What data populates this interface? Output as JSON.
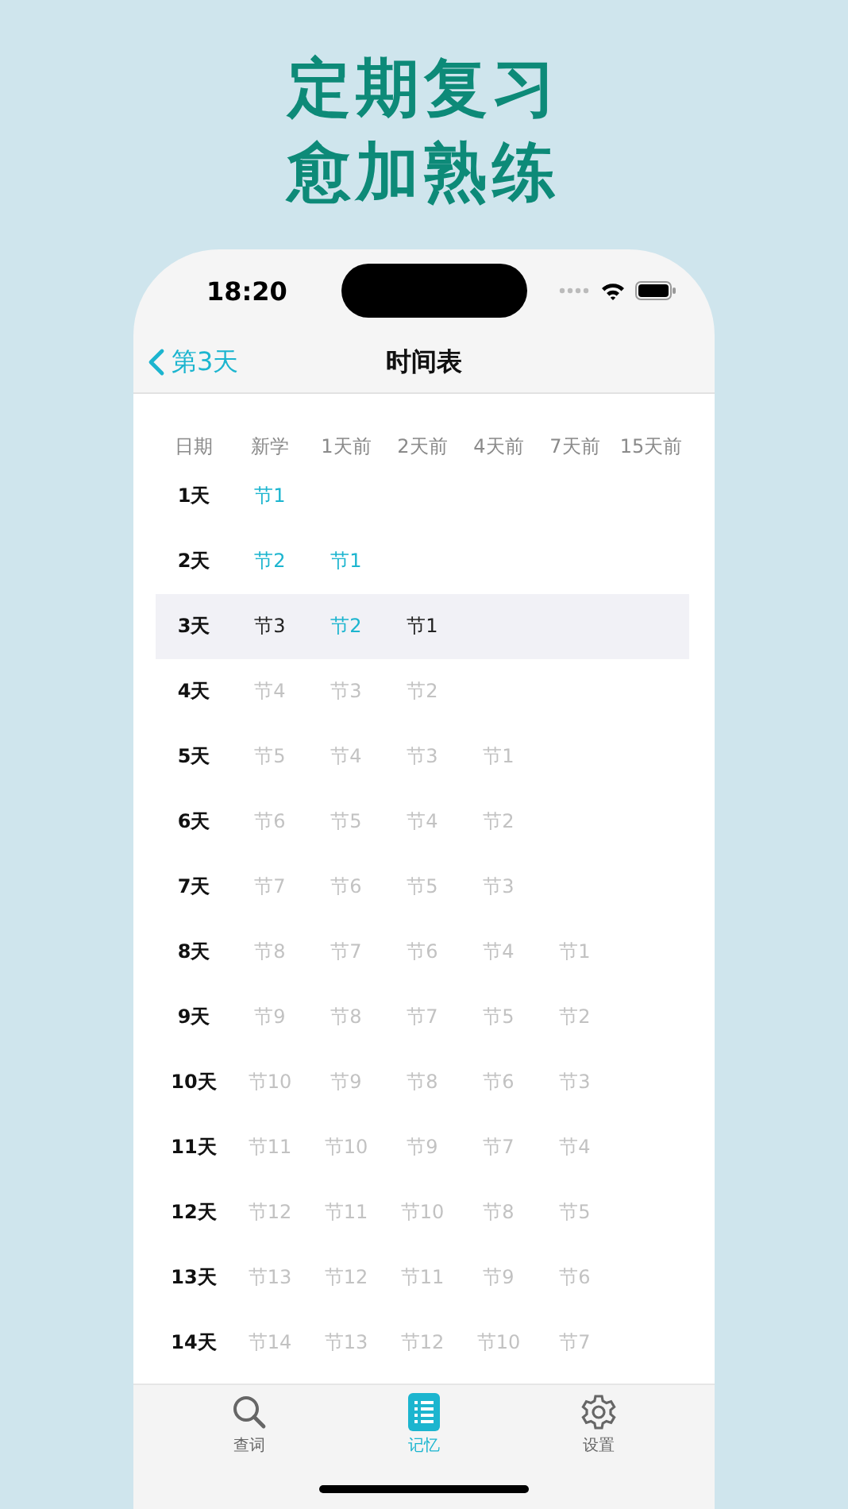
{
  "headline": [
    "定期复习",
    "愈加熟练"
  ],
  "status_bar": {
    "time": "18:20"
  },
  "nav": {
    "back": "第3天",
    "title": "时间表"
  },
  "table": {
    "columns": [
      "日期",
      "新学",
      "1天前",
      "2天前",
      "4天前",
      "7天前",
      "15天前"
    ],
    "rows": [
      {
        "selected": false,
        "cells": [
          {
            "text": "1天",
            "kind": "day"
          },
          {
            "text": "节1",
            "kind": "review"
          }
        ]
      },
      {
        "selected": false,
        "cells": [
          {
            "text": "2天",
            "kind": "day"
          },
          {
            "text": "节2",
            "kind": "review"
          },
          {
            "text": "节1",
            "kind": "review"
          }
        ]
      },
      {
        "selected": true,
        "cells": [
          {
            "text": "3天",
            "kind": "day"
          },
          {
            "text": "节3",
            "kind": "current"
          },
          {
            "text": "节2",
            "kind": "review"
          },
          {
            "text": "节1",
            "kind": "current"
          }
        ]
      },
      {
        "selected": false,
        "cells": [
          {
            "text": "4天",
            "kind": "day"
          },
          {
            "text": "节4",
            "kind": "future"
          },
          {
            "text": "节3",
            "kind": "future"
          },
          {
            "text": "节2",
            "kind": "future"
          }
        ]
      },
      {
        "selected": false,
        "cells": [
          {
            "text": "5天",
            "kind": "day"
          },
          {
            "text": "节5",
            "kind": "future"
          },
          {
            "text": "节4",
            "kind": "future"
          },
          {
            "text": "节3",
            "kind": "future"
          },
          {
            "text": "节1",
            "kind": "future"
          }
        ]
      },
      {
        "selected": false,
        "cells": [
          {
            "text": "6天",
            "kind": "day"
          },
          {
            "text": "节6",
            "kind": "future"
          },
          {
            "text": "节5",
            "kind": "future"
          },
          {
            "text": "节4",
            "kind": "future"
          },
          {
            "text": "节2",
            "kind": "future"
          }
        ]
      },
      {
        "selected": false,
        "cells": [
          {
            "text": "7天",
            "kind": "day"
          },
          {
            "text": "节7",
            "kind": "future"
          },
          {
            "text": "节6",
            "kind": "future"
          },
          {
            "text": "节5",
            "kind": "future"
          },
          {
            "text": "节3",
            "kind": "future"
          }
        ]
      },
      {
        "selected": false,
        "cells": [
          {
            "text": "8天",
            "kind": "day"
          },
          {
            "text": "节8",
            "kind": "future"
          },
          {
            "text": "节7",
            "kind": "future"
          },
          {
            "text": "节6",
            "kind": "future"
          },
          {
            "text": "节4",
            "kind": "future"
          },
          {
            "text": "节1",
            "kind": "future"
          }
        ]
      },
      {
        "selected": false,
        "cells": [
          {
            "text": "9天",
            "kind": "day"
          },
          {
            "text": "节9",
            "kind": "future"
          },
          {
            "text": "节8",
            "kind": "future"
          },
          {
            "text": "节7",
            "kind": "future"
          },
          {
            "text": "节5",
            "kind": "future"
          },
          {
            "text": "节2",
            "kind": "future"
          }
        ]
      },
      {
        "selected": false,
        "cells": [
          {
            "text": "10天",
            "kind": "day"
          },
          {
            "text": "节10",
            "kind": "future"
          },
          {
            "text": "节9",
            "kind": "future"
          },
          {
            "text": "节8",
            "kind": "future"
          },
          {
            "text": "节6",
            "kind": "future"
          },
          {
            "text": "节3",
            "kind": "future"
          }
        ]
      },
      {
        "selected": false,
        "cells": [
          {
            "text": "11天",
            "kind": "day"
          },
          {
            "text": "节11",
            "kind": "future"
          },
          {
            "text": "节10",
            "kind": "future"
          },
          {
            "text": "节9",
            "kind": "future"
          },
          {
            "text": "节7",
            "kind": "future"
          },
          {
            "text": "节4",
            "kind": "future"
          }
        ]
      },
      {
        "selected": false,
        "cells": [
          {
            "text": "12天",
            "kind": "day"
          },
          {
            "text": "节12",
            "kind": "future"
          },
          {
            "text": "节11",
            "kind": "future"
          },
          {
            "text": "节10",
            "kind": "future"
          },
          {
            "text": "节8",
            "kind": "future"
          },
          {
            "text": "节5",
            "kind": "future"
          }
        ]
      },
      {
        "selected": false,
        "cells": [
          {
            "text": "13天",
            "kind": "day"
          },
          {
            "text": "节13",
            "kind": "future"
          },
          {
            "text": "节12",
            "kind": "future"
          },
          {
            "text": "节11",
            "kind": "future"
          },
          {
            "text": "节9",
            "kind": "future"
          },
          {
            "text": "节6",
            "kind": "future"
          }
        ]
      },
      {
        "selected": false,
        "cells": [
          {
            "text": "14天",
            "kind": "day"
          },
          {
            "text": "节14",
            "kind": "future"
          },
          {
            "text": "节13",
            "kind": "future"
          },
          {
            "text": "节12",
            "kind": "future"
          },
          {
            "text": "节10",
            "kind": "future"
          },
          {
            "text": "节7",
            "kind": "future"
          }
        ]
      }
    ]
  },
  "tab_bar": [
    {
      "label": "查词",
      "kind": "search",
      "selected": false
    },
    {
      "label": "记忆",
      "kind": "list",
      "selected": true
    },
    {
      "label": "设置",
      "kind": "settings",
      "selected": false
    }
  ]
}
